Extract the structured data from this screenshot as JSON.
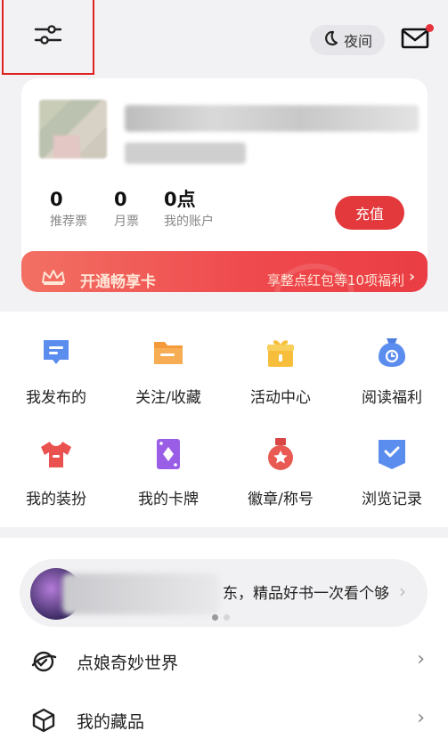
{
  "topbar": {
    "night_label": "夜间",
    "has_unread_mail": true
  },
  "account": {
    "stats": [
      {
        "value": "0",
        "label": "推荐票"
      },
      {
        "value": "0",
        "label": "月票"
      },
      {
        "value": "0点",
        "label": "我的账户"
      }
    ],
    "recharge_label": "充值",
    "vip_title": "开通畅享卡",
    "vip_perk": "享整点红包等10项福利"
  },
  "grid": [
    {
      "label": "我发布的",
      "icon": "post-icon"
    },
    {
      "label": "关注/收藏",
      "icon": "folder-icon"
    },
    {
      "label": "活动中心",
      "icon": "gift-icon"
    },
    {
      "label": "阅读福利",
      "icon": "bag-clock-icon"
    },
    {
      "label": "我的装扮",
      "icon": "tshirt-icon"
    },
    {
      "label": "我的卡牌",
      "icon": "card-icon"
    },
    {
      "label": "徽章/称号",
      "icon": "badge-icon"
    },
    {
      "label": "浏览记录",
      "icon": "history-icon"
    }
  ],
  "promo": {
    "text": "东，精品好书一次看个够"
  },
  "list": [
    {
      "label": "点娘奇妙世界",
      "icon": "world-icon"
    },
    {
      "label": "我的藏品",
      "icon": "collection-icon"
    }
  ],
  "colors": {
    "accent_red": "#e3393c",
    "background": "#f2f2f4"
  }
}
